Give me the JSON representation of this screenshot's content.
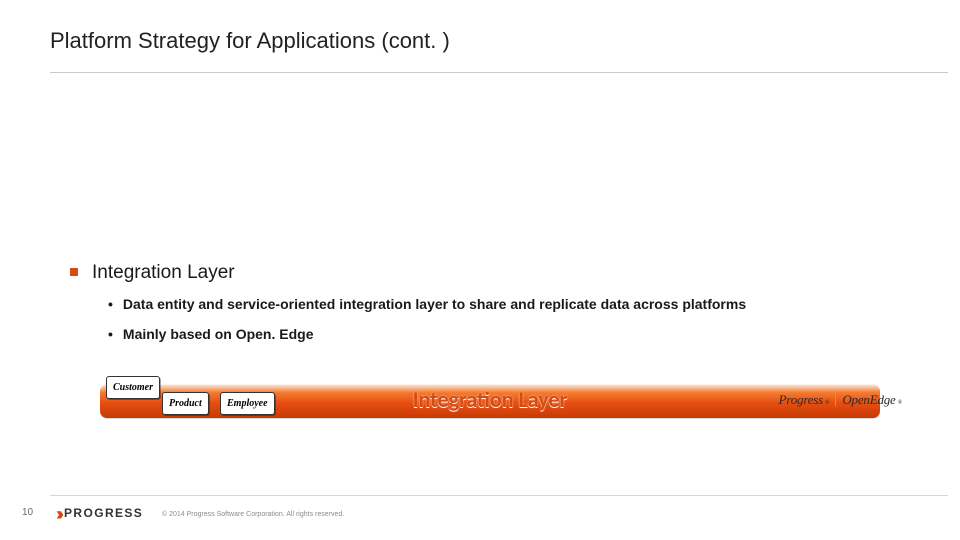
{
  "title": "Platform Strategy for Applications (cont. )",
  "section": {
    "heading": "Integration Layer",
    "bullets": [
      "Data entity and service-oriented integration layer to share and replicate data across platforms",
      "Mainly based on Open. Edge"
    ]
  },
  "bar": {
    "label": "Integration Layer",
    "chips": [
      "Customer",
      "Product",
      "Employee"
    ],
    "brand": {
      "left": "Progress",
      "right": "OpenEdge"
    }
  },
  "footer": {
    "page": "10",
    "logo_text": "PROGRESS",
    "copyright": "© 2014 Progress Software Corporation. All rights reserved."
  },
  "colors": {
    "accent": "#d44d13"
  }
}
